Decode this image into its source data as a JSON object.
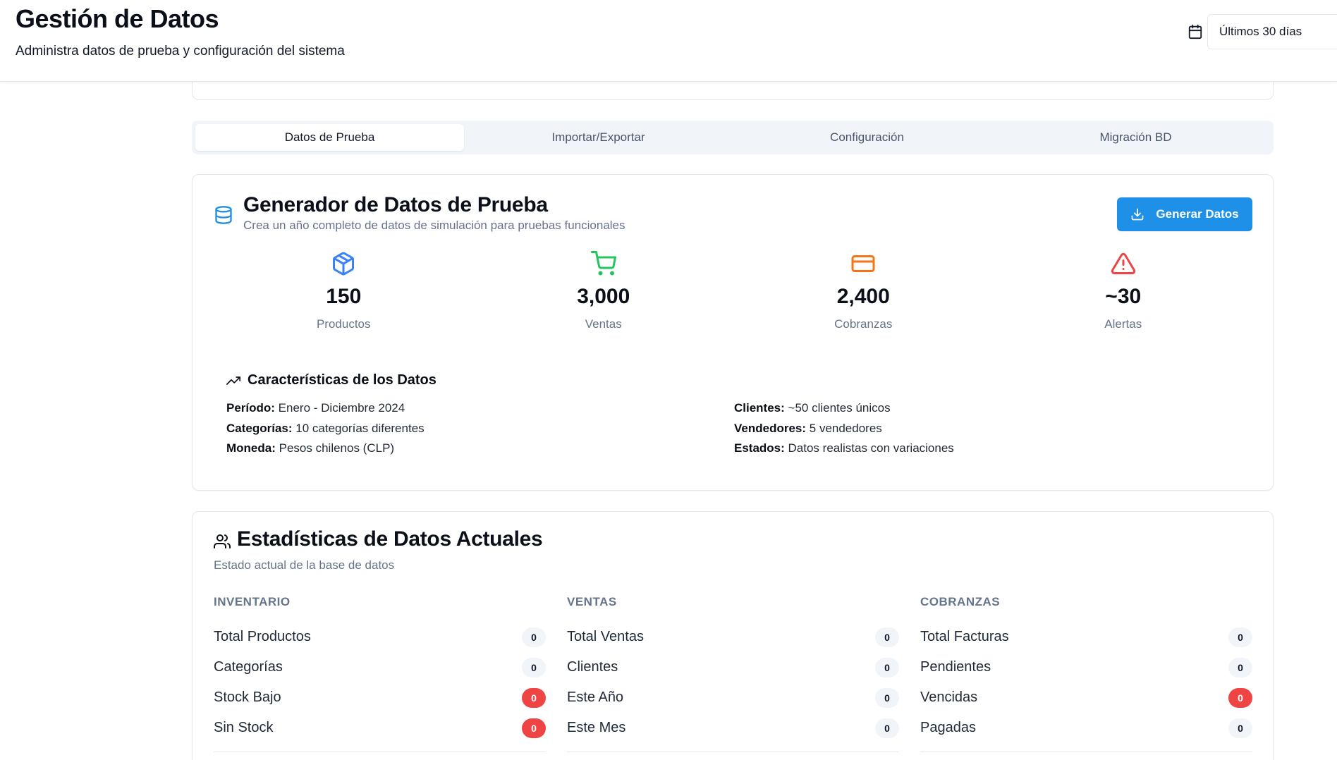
{
  "header": {
    "title": "Gestión de Datos",
    "subtitle": "Administra datos de prueba y configuración del sistema",
    "date_range": "Últimos 30 días"
  },
  "tabs": [
    {
      "label": "Datos de Prueba",
      "active": true
    },
    {
      "label": "Importar/Exportar",
      "active": false
    },
    {
      "label": "Configuración",
      "active": false
    },
    {
      "label": "Migración BD",
      "active": false
    }
  ],
  "generator": {
    "title": "Generador de Datos de Prueba",
    "description": "Crea un año completo de datos de simulación para pruebas funcionales",
    "button_label": "Generar Datos",
    "metrics": [
      {
        "icon": "package-icon",
        "value": "150",
        "label": "Productos",
        "color": "#3b82f6"
      },
      {
        "icon": "cart-icon",
        "value": "3,000",
        "label": "Ventas",
        "color": "#22c55e"
      },
      {
        "icon": "credit-card-icon",
        "value": "2,400",
        "label": "Cobranzas",
        "color": "#f97316"
      },
      {
        "icon": "alert-triangle-icon",
        "value": "~30",
        "label": "Alertas",
        "color": "#ef4444"
      }
    ],
    "features_title": "Características de los Datos",
    "features_left": [
      {
        "key": "Período:",
        "value": " Enero - Diciembre 2024"
      },
      {
        "key": "Categorías:",
        "value": " 10 categorías diferentes"
      },
      {
        "key": "Moneda:",
        "value": " Pesos chilenos (CLP)"
      }
    ],
    "features_right": [
      {
        "key": "Clientes:",
        "value": " ~50 clientes únicos"
      },
      {
        "key": "Vendedores:",
        "value": " 5 vendedores"
      },
      {
        "key": "Estados:",
        "value": " Datos realistas con variaciones"
      }
    ]
  },
  "stats": {
    "title": "Estadísticas de Datos Actuales",
    "description": "Estado actual de la base de datos",
    "columns": [
      {
        "heading": "INVENTARIO",
        "rows": [
          {
            "label": "Total Productos",
            "count": "0",
            "danger": false
          },
          {
            "label": "Categorías",
            "count": "0",
            "danger": false
          },
          {
            "label": "Stock Bajo",
            "count": "0",
            "danger": true
          },
          {
            "label": "Sin Stock",
            "count": "0",
            "danger": true
          }
        ]
      },
      {
        "heading": "VENTAS",
        "rows": [
          {
            "label": "Total Ventas",
            "count": "0",
            "danger": false
          },
          {
            "label": "Clientes",
            "count": "0",
            "danger": false
          },
          {
            "label": "Este Año",
            "count": "0",
            "danger": false
          },
          {
            "label": "Este Mes",
            "count": "0",
            "danger": false
          }
        ]
      },
      {
        "heading": "COBRANZAS",
        "rows": [
          {
            "label": "Total Facturas",
            "count": "0",
            "danger": false
          },
          {
            "label": "Pendientes",
            "count": "0",
            "danger": false
          },
          {
            "label": "Vencidas",
            "count": "0",
            "danger": true
          },
          {
            "label": "Pagadas",
            "count": "0",
            "danger": false
          }
        ]
      }
    ]
  },
  "colors": {
    "accent": "#1e90e8",
    "danger": "#ef4444"
  }
}
